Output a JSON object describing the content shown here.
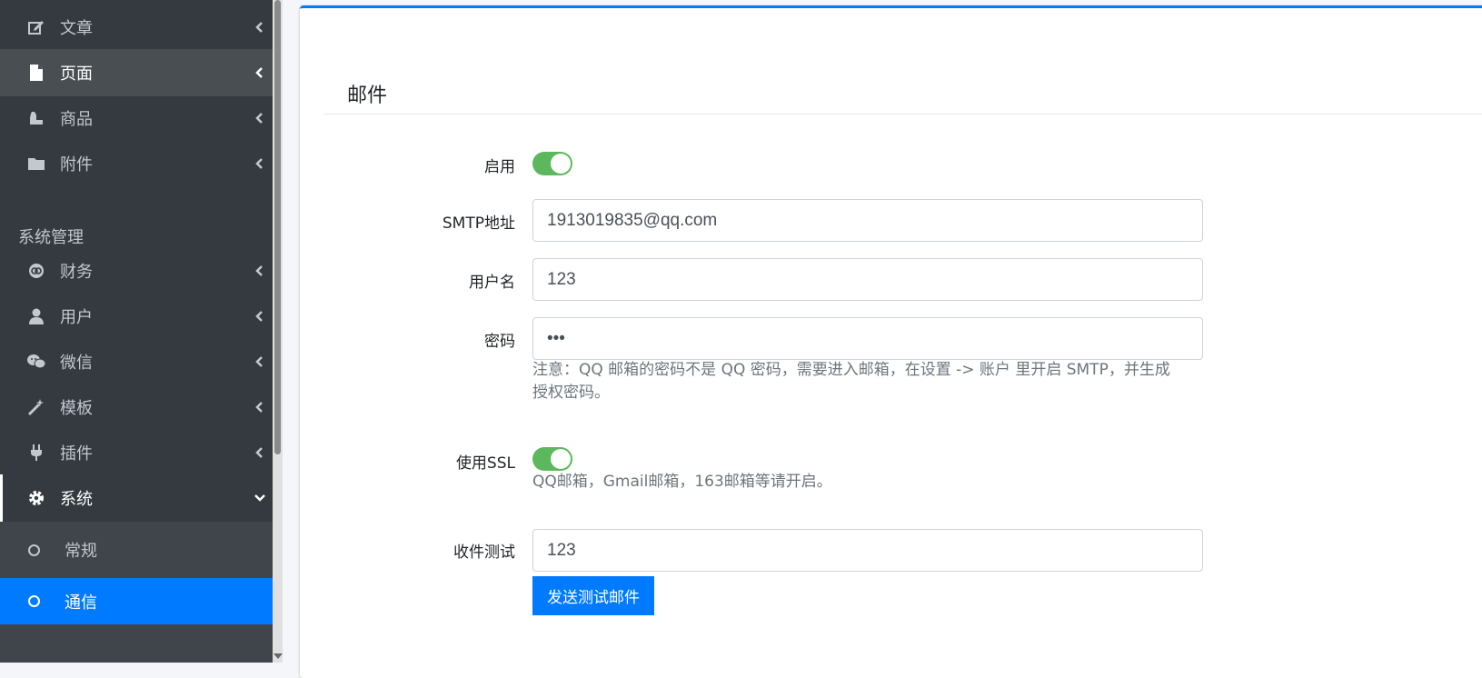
{
  "sidebar": {
    "items": [
      {
        "label": "文章",
        "icon": "edit-icon"
      },
      {
        "label": "页面",
        "icon": "file-icon"
      },
      {
        "label": "商品",
        "icon": "shopping-icon"
      },
      {
        "label": "附件",
        "icon": "folder-icon"
      }
    ],
    "section_title": "系统管理",
    "system_items": [
      {
        "label": "财务",
        "icon": "finance-icon"
      },
      {
        "label": "用户",
        "icon": "user-icon"
      },
      {
        "label": "微信",
        "icon": "wechat-icon"
      },
      {
        "label": "模板",
        "icon": "magic-wand-icon"
      },
      {
        "label": "插件",
        "icon": "plug-icon"
      },
      {
        "label": "系统",
        "icon": "gear-icon"
      }
    ],
    "sub_items": [
      {
        "label": "常规"
      },
      {
        "label": "通信"
      }
    ]
  },
  "card": {
    "title": "邮件"
  },
  "form": {
    "enable_label": "启用",
    "enable_on": true,
    "smtp_label": "SMTP地址",
    "smtp_value": "1913019835@qq.com",
    "username_label": "用户名",
    "username_value": "123",
    "password_label": "密码",
    "password_value": "•••",
    "password_help": "注意：QQ 邮箱的密码不是 QQ 密码，需要进入邮箱，在设置 -> 账户 里开启 SMTP，并生成授权密码。",
    "ssl_label": "使用SSL",
    "ssl_on": true,
    "ssl_help": "QQ邮箱，Gmail邮箱，163邮箱等请开启。",
    "test_label": "收件测试",
    "test_value": "123",
    "send_button": "发送测试邮件"
  },
  "colors": {
    "sidebar_bg": "#343a40",
    "accent": "#007bff",
    "toggle_on": "#5cb85c"
  }
}
